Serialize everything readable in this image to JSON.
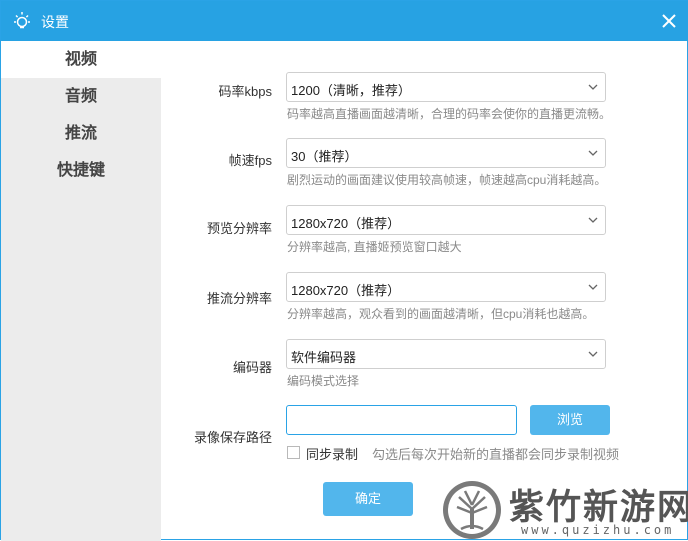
{
  "window": {
    "title": "设置",
    "title_icon": "lightbulb-icon",
    "close_icon": "close-icon",
    "accent_color": "#27a2e3"
  },
  "sidebar": {
    "items": [
      {
        "label": "视频",
        "active": true
      },
      {
        "label": "音频",
        "active": false
      },
      {
        "label": "推流",
        "active": false
      },
      {
        "label": "快捷键",
        "active": false
      }
    ]
  },
  "settings": {
    "bitrate": {
      "label": "码率kbps",
      "value": "1200（清晰，推荐）",
      "hint": "码率越高直播画面越清晰，合理的码率会使你的直播更流畅。"
    },
    "fps": {
      "label": "帧速fps",
      "value": "30（推荐）",
      "hint": "剧烈运动的画面建议使用较高帧速，帧速越高cpu消耗越高。"
    },
    "preview_resolution": {
      "label": "预览分辨率",
      "value": "1280x720（推荐）",
      "hint": "分辨率越高, 直播姬预览窗口越大"
    },
    "stream_resolution": {
      "label": "推流分辨率",
      "value": "1280x720（推荐）",
      "hint": "分辨率越高，观众看到的画面越清晰，但cpu消耗也越高。"
    },
    "encoder": {
      "label": "编码器",
      "value": "软件编码器",
      "hint": "编码模式选择"
    },
    "record_path": {
      "label": "录像保存路径",
      "value": "",
      "browse_label": "浏览",
      "sync_record_label": "同步录制",
      "sync_record_checked": false,
      "sync_record_hint": "勾选后每次开始新的直播都会同步录制视频"
    }
  },
  "footer": {
    "ok_label": "确定"
  },
  "watermark": {
    "text": "紫竹新游网",
    "url": "www.quzizhu.com"
  }
}
